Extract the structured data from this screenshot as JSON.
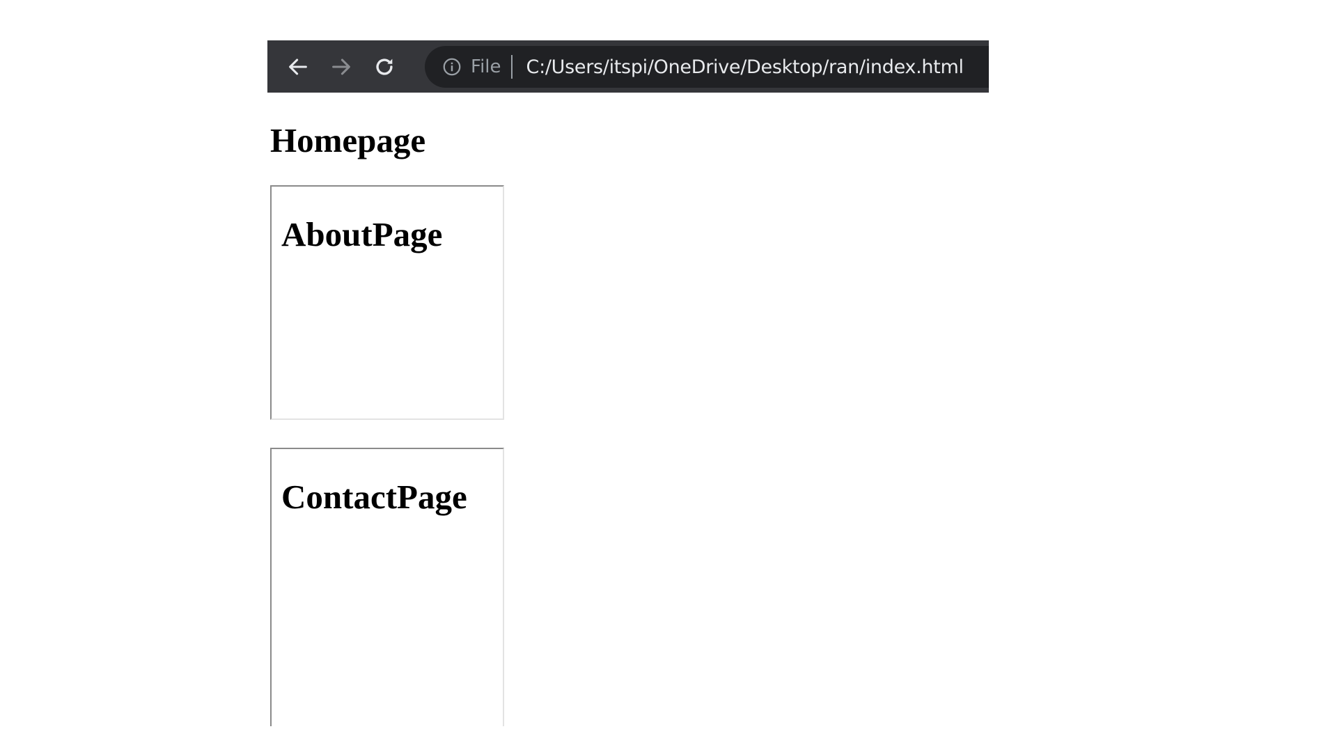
{
  "browser": {
    "nav": {
      "back_icon": "arrow-left-icon",
      "forward_icon": "arrow-right-icon",
      "reload_icon": "reload-icon"
    },
    "omnibox": {
      "info_icon": "info-icon",
      "scheme_label": "File",
      "url": "C:/Users/itspi/OneDrive/Desktop/ran/index.html"
    }
  },
  "page": {
    "title": "Homepage",
    "frames": [
      {
        "title": "AboutPage"
      },
      {
        "title": "ContactPage"
      }
    ]
  },
  "colors": {
    "toolbar_bg": "#35363a",
    "omnibox_bg": "#202124",
    "url_text": "#e8eaed",
    "muted_text": "#9aa0a6"
  }
}
